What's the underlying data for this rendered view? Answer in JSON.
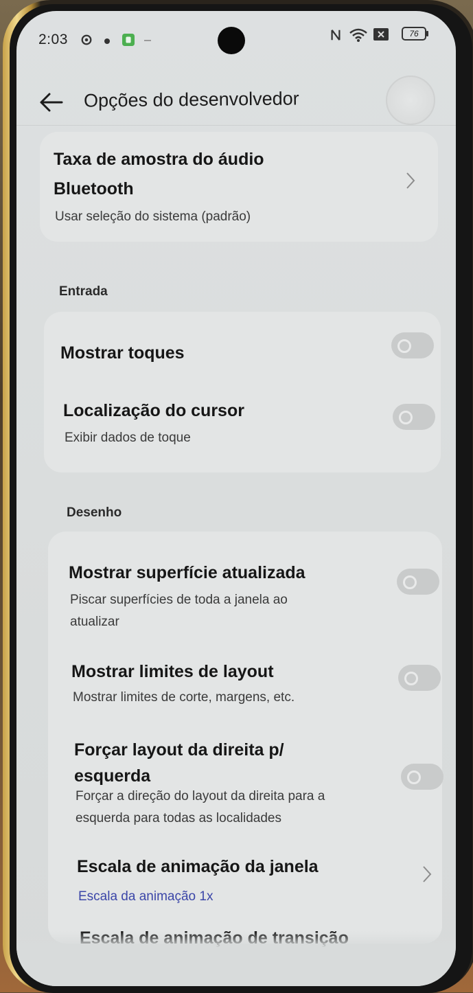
{
  "status_bar": {
    "time": "2:03",
    "battery": "76"
  },
  "header": {
    "title": "Opções do desenvolvedor"
  },
  "items": {
    "bluetooth_sample_rate": {
      "title_line1": "Taxa de amostra do áudio",
      "title_line2": "Bluetooth",
      "subtitle": "Usar seleção do sistema (padrão)"
    },
    "show_taps": {
      "title": "Mostrar toques",
      "enabled": false
    },
    "pointer_location": {
      "title": "Localização do cursor",
      "subtitle": "Exibir dados de toque",
      "enabled": false
    },
    "show_surface_updates": {
      "title": "Mostrar superfície atualizada",
      "subtitle_line1": "Piscar superfícies de toda a janela ao",
      "subtitle_line2": "atualizar",
      "enabled": false
    },
    "show_layout_bounds": {
      "title": "Mostrar limites de layout",
      "subtitle": "Mostrar limites de corte, margens, etc.",
      "enabled": false
    },
    "force_rtl": {
      "title_line1": "Forçar layout da direita p/",
      "title_line2": "esquerda",
      "subtitle_line1": "Forçar a direção do layout da direita para a",
      "subtitle_line2": "esquerda para todas as localidades",
      "enabled": false
    },
    "window_animation_scale": {
      "title": "Escala de animação da janela",
      "subtitle": "Escala da animação 1x"
    },
    "transition_animation_scale": {
      "title": "Escala de animação de transição"
    }
  },
  "sections": {
    "input": "Entrada",
    "drawing": "Desenho"
  },
  "colors": {
    "accent": "#3b46a8",
    "background": "#dcdfdf",
    "card": "#e3e5e5",
    "toggle_off": "#c9cbcb"
  },
  "icons": {
    "back": "arrow-left-icon",
    "chevron": "chevron-right-icon"
  }
}
